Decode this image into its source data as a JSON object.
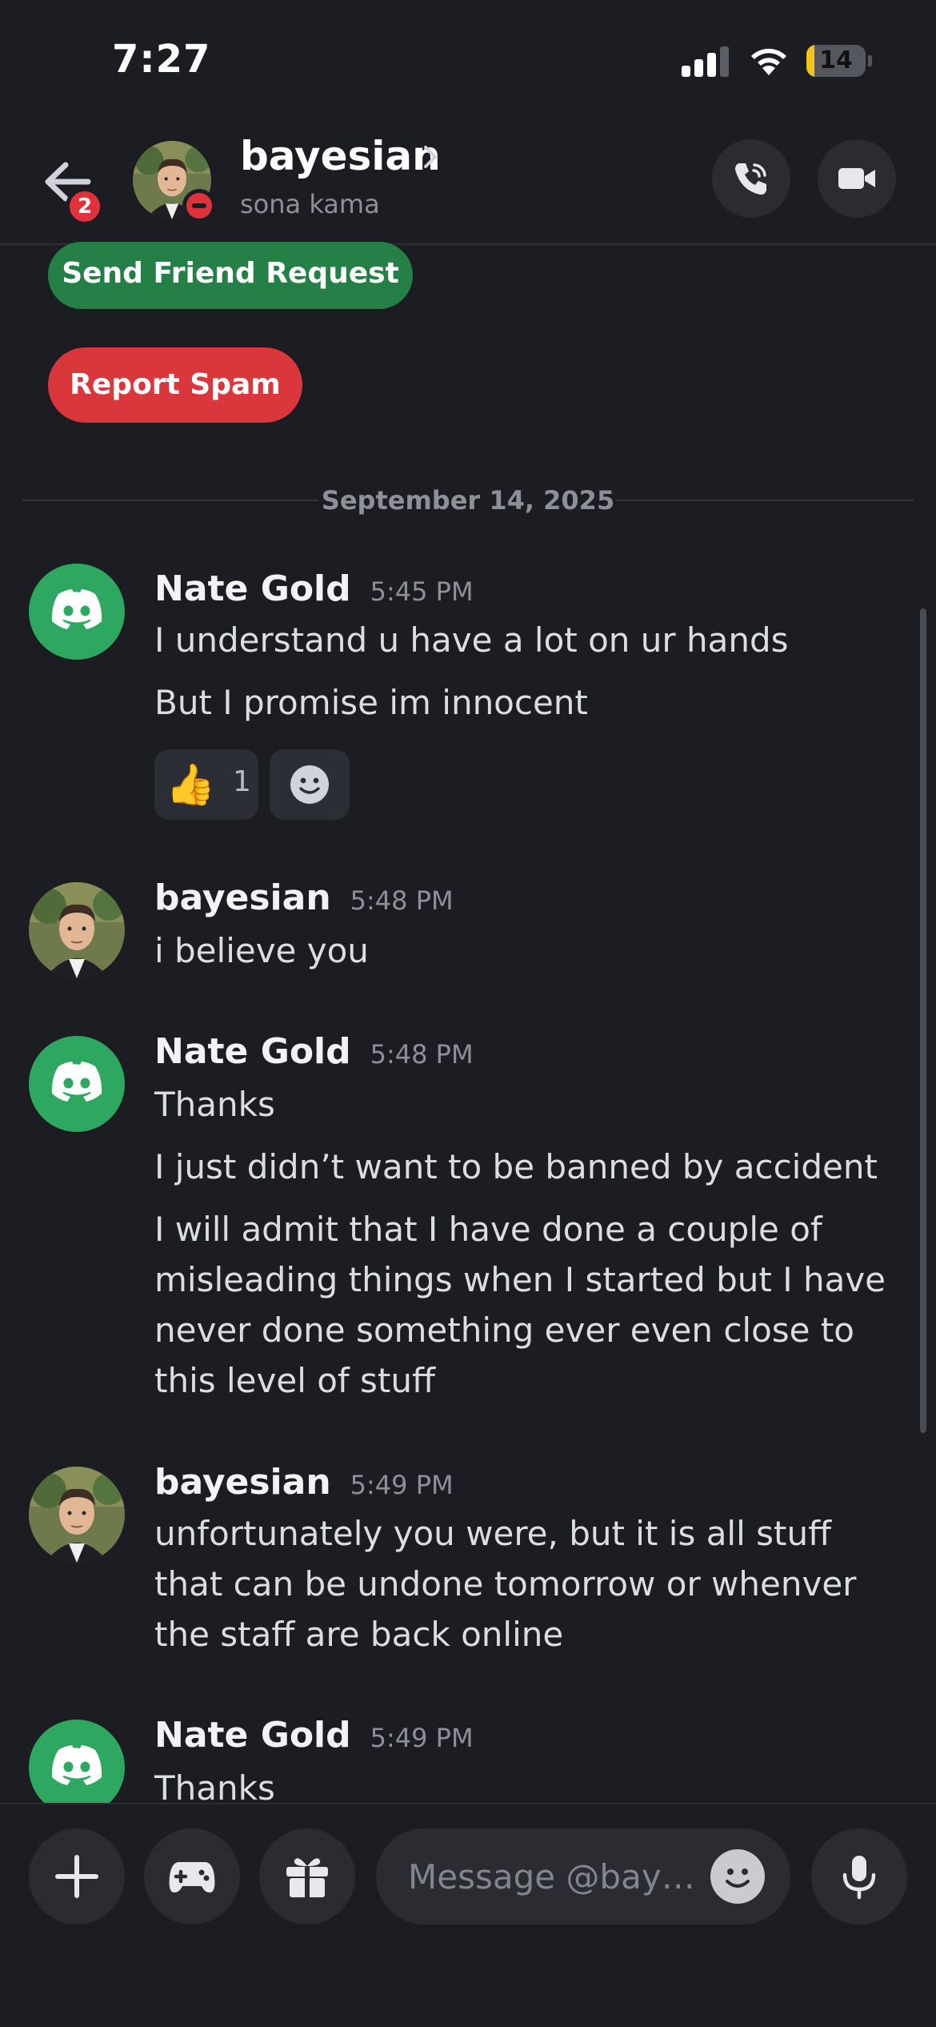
{
  "status_bar": {
    "time": "7:27",
    "battery_level": "14",
    "battery_fraction": 0.14,
    "battery_color": "#f2c41b",
    "signal_bars_active": 3
  },
  "header": {
    "back_icon": "arrow-left-icon",
    "unread_badge": "2",
    "name": "bayesian",
    "subtitle": "sona kama",
    "status": "do-not-disturb",
    "call_icon": "phone-call-icon",
    "video_icon": "video-camera-icon"
  },
  "actions": {
    "send_friend_request": "Send Friend Request",
    "report_spam": "Report Spam",
    "friend_color": "#248046",
    "spam_color": "#da373c"
  },
  "date_divider": "September 14, 2025",
  "messages": [
    {
      "author": "Nate Gold",
      "time": "5:45 PM",
      "avatar": "discord-logo-icon",
      "lines": [
        "I understand u have a lot on ur hands",
        "But I promise im innocent"
      ],
      "reactions": [
        {
          "emoji": "👍",
          "count": "1"
        }
      ],
      "add_reaction_icon": "add-reaction-icon"
    },
    {
      "author": "bayesian",
      "time": "5:48 PM",
      "avatar": "user-portrait",
      "lines": [
        "i believe you"
      ]
    },
    {
      "author": "Nate Gold",
      "time": "5:48 PM",
      "avatar": "discord-logo-icon",
      "lines": [
        "Thanks",
        "I just didn’t want to be banned by accident",
        "I will admit that I have done a couple of misleading things when I started but I have never done something ever even close to this level of stuff"
      ]
    },
    {
      "author": "bayesian",
      "time": "5:49 PM",
      "avatar": "user-portrait",
      "lines": [
        "unfortunately you were, but it is all stuff that can be undone tomorrow or whenver the staff are back online"
      ]
    },
    {
      "author": "Nate Gold",
      "time": "5:49 PM",
      "avatar": "discord-logo-icon",
      "lines": [
        "Thanks"
      ]
    }
  ],
  "composer": {
    "placeholder": "Message @baye…",
    "buttons": [
      "plus-icon",
      "gamepad-icon",
      "gift-icon",
      "emoji-icon",
      "microphone-icon"
    ]
  },
  "colors": {
    "background": "#1c1d22",
    "discord_green": "#2ea860",
    "badge_red": "#e0323b"
  }
}
